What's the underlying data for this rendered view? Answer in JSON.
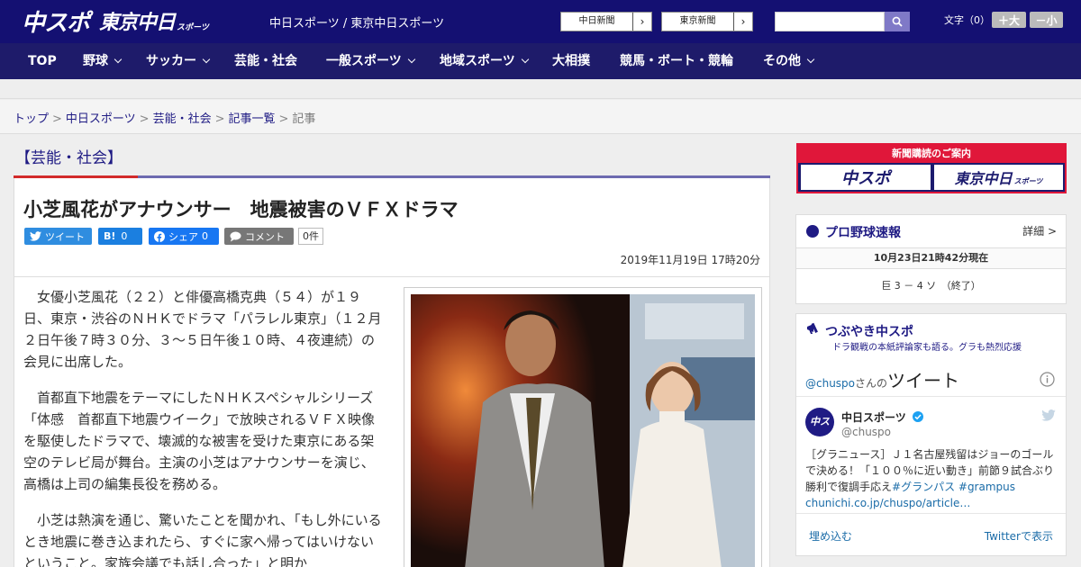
{
  "header": {
    "logo_chuspo": "中スポ",
    "logo_tokyo": "東京中日",
    "logo_tokyo_small": "スポーツ",
    "site_links": "中日スポーツ / 東京中日スポーツ",
    "paper_link_1": "中日新聞",
    "paper_link_2": "東京新聞",
    "link_arrow": "›",
    "search_icon": "search-icon",
    "fontsize_label": "文字（0）",
    "font_larger": "＋大",
    "font_smaller": "－小"
  },
  "nav": {
    "items": [
      "TOP",
      "野球",
      "サッカー",
      "芸能・社会",
      "一般スポーツ",
      "地域スポーツ",
      "大相撲",
      "競馬・ボート・競輪",
      "その他"
    ]
  },
  "breadcrumb": {
    "items": [
      "トップ",
      "中日スポーツ",
      "芸能・社会",
      "記事一覧"
    ],
    "current": "記事",
    "separator": ">"
  },
  "article": {
    "category": "【芸能・社会】",
    "headline": "小芝風花がアナウンサー　地震被害のＶＦＸドラマ",
    "share": {
      "tweet": "ツイート",
      "hatena_mark": "B!",
      "hatena_count": "0",
      "facebook": "シェア",
      "facebook_count": "0",
      "comment": "コメント",
      "comment_count": "0件"
    },
    "date": "2019年11月19日 17時20分",
    "paragraphs": [
      "女優小芝風花（２２）と俳優高橋克典（５４）が１９日、東京・渋谷のＮＨＫでドラマ「パラレル東京」（１２月２日午後７時３０分、３～５日午後１０時、４夜連続）の会見に出席した。",
      "首都直下地震をテーマにしたＮＨＫスペシャルシリーズ「体感　首都直下地震ウイーク」で放映されるＶＦＸ映像を駆使したドラマで、壊滅的な被害を受けた東京にある架空のテレビ局が舞台。主演の小芝はアナウンサーを演じ、高橋は上司の編集長役を務める。",
      "小芝は熱演を通じ、驚いたことを聞かれ、「もし外にいるとき地震に巻き込まれたら、すぐに家へ帰ってはいけないということ。家族会議でも話し合った」と明か"
    ]
  },
  "sidebar": {
    "ad_title": "新聞購読のご案内",
    "ad_logo_1": "中スポ",
    "ad_logo_2": "東京中日",
    "ad_logo_2_small": "スポーツ",
    "baseball": {
      "title": "プロ野球速報",
      "detail": "詳細 >",
      "updated": "10月23日21時42分現在",
      "result": "巨 3 － 4 ソ　（終了）"
    },
    "twitter": {
      "title": "つぶやき中スポ",
      "subtitle": "ドラ観戦の本紙評論家も語る。グラも熱烈応援",
      "handle_link": "@chuspo",
      "handle_suffix": "さんの",
      "tweets_label": "ツイート",
      "account_name": "中日スポーツ",
      "account_handle": "@chuspo",
      "tweet_text_1": "［グラニュース］Ｊ１名古屋残留はジョーのゴールで決める！「１００％に近い動き」前節９試合ぶり勝利で復調手応え",
      "tweet_hashtags": "#グランパス #grampus",
      "tweet_link": "chunichi.co.jp/chuspo/article…",
      "embed": "埋め込む",
      "view_on_twitter": "Twitterで表示"
    }
  }
}
